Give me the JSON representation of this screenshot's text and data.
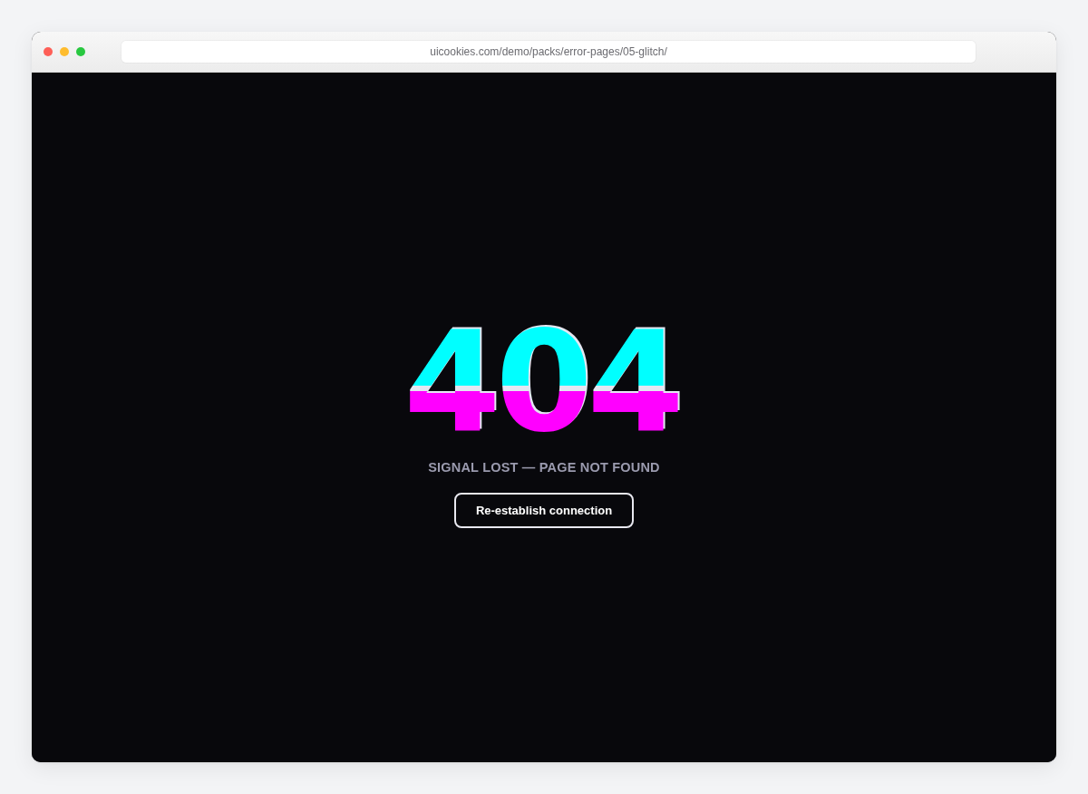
{
  "browser": {
    "url": "uicookies.com/demo/packs/error-pages/05-glitch/"
  },
  "page": {
    "code": "404",
    "message": "SIGNAL LOST — PAGE NOT FOUND",
    "button": "Re-establish connection"
  }
}
